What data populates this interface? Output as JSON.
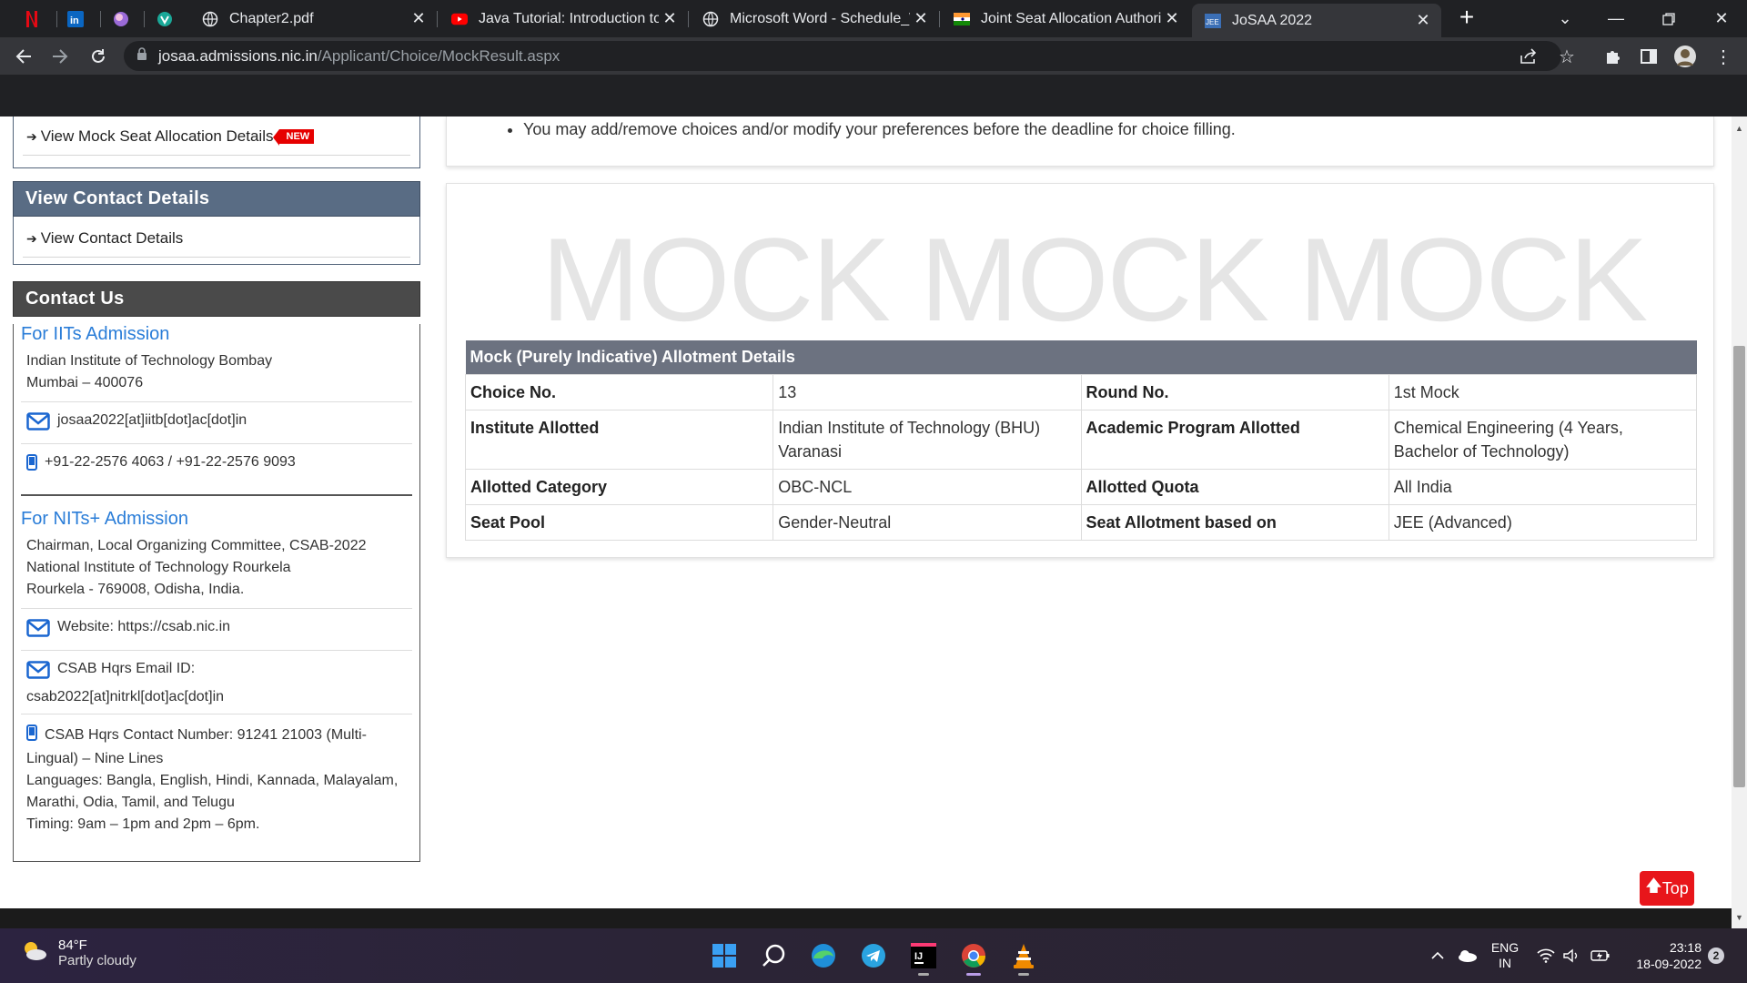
{
  "browser": {
    "tabs": [
      {
        "title": "Chapter2.pdf",
        "icon": "globe-icon"
      },
      {
        "title": "Java Tutorial: Introduction to",
        "icon": "youtube-icon"
      },
      {
        "title": "Microsoft Word - Schedule_W",
        "icon": "globe-icon"
      },
      {
        "title": "Joint Seat Allocation Authorit",
        "icon": "india-flag-icon"
      },
      {
        "title": "JoSAA 2022",
        "icon": "josaa-icon",
        "active": true
      }
    ],
    "url_host": "josaa.admissions.nic.in",
    "url_path": "/Applicant/Choice/MockResult.aspx",
    "new_tab_label": "+"
  },
  "sidebar": {
    "mock_link": "View Mock Seat Allocation Details",
    "new_badge": "NEW",
    "contact_details_heading": "View Contact Details",
    "contact_details_link": "View Contact Details",
    "contact_us_heading": "Contact Us",
    "iit": {
      "title": "For IITs Admission",
      "address1": "Indian Institute of Technology Bombay",
      "address2": "Mumbai – 400076",
      "email": "josaa2022[at]iitb[dot]ac[dot]in",
      "phone": "+91-22-2576 4063 / +91-22-2576 9093"
    },
    "nit": {
      "title": "For NITs+ Admission",
      "address1": "Chairman, Local Organizing Committee, CSAB-2022",
      "address2": "National Institute of Technology Rourkela",
      "address3": "Rourkela - 769008, Odisha, India.",
      "website": "Website: https://csab.nic.in",
      "email_label": "CSAB Hqrs Email ID:",
      "email": "csab2022[at]nitrkl[dot]ac[dot]in",
      "contact_number": "CSAB Hqrs Contact Number: 91241 21003 (Multi-Lingual) – Nine Lines",
      "languages": "Languages: Bangla, English, Hindi, Kannada, Malayalam, Marathi, Odia, Tamil, and Telugu",
      "timing": "Timing: 9am – 1pm and 2pm – 6pm."
    }
  },
  "main": {
    "notice": "You may add/remove choices and/or modify your preferences before the deadline for choice filling.",
    "watermark": "MOCK MOCK MOCK",
    "table_title": "Mock (Purely Indicative) Allotment Details",
    "rows": [
      {
        "l1": "Choice No.",
        "v1": "13",
        "l2": "Round No.",
        "v2": "1st Mock"
      },
      {
        "l1": "Institute Allotted",
        "v1": "Indian Institute of Technology (BHU) Varanasi",
        "l2": "Academic Program Allotted",
        "v2": "Chemical Engineering (4 Years, Bachelor of Technology)"
      },
      {
        "l1": "Allotted Category",
        "v1": "OBC-NCL",
        "l2": "Allotted Quota",
        "v2": "All India"
      },
      {
        "l1": "Seat Pool",
        "v1": "Gender-Neutral",
        "l2": "Seat Allotment based on",
        "v2": "JEE (Advanced)"
      }
    ],
    "top_button": "Top"
  },
  "taskbar": {
    "temperature": "84°F",
    "weather": "Partly cloudy",
    "lang1": "ENG",
    "lang2": "IN",
    "time": "23:18",
    "date": "18-09-2022",
    "notification_count": "2"
  }
}
